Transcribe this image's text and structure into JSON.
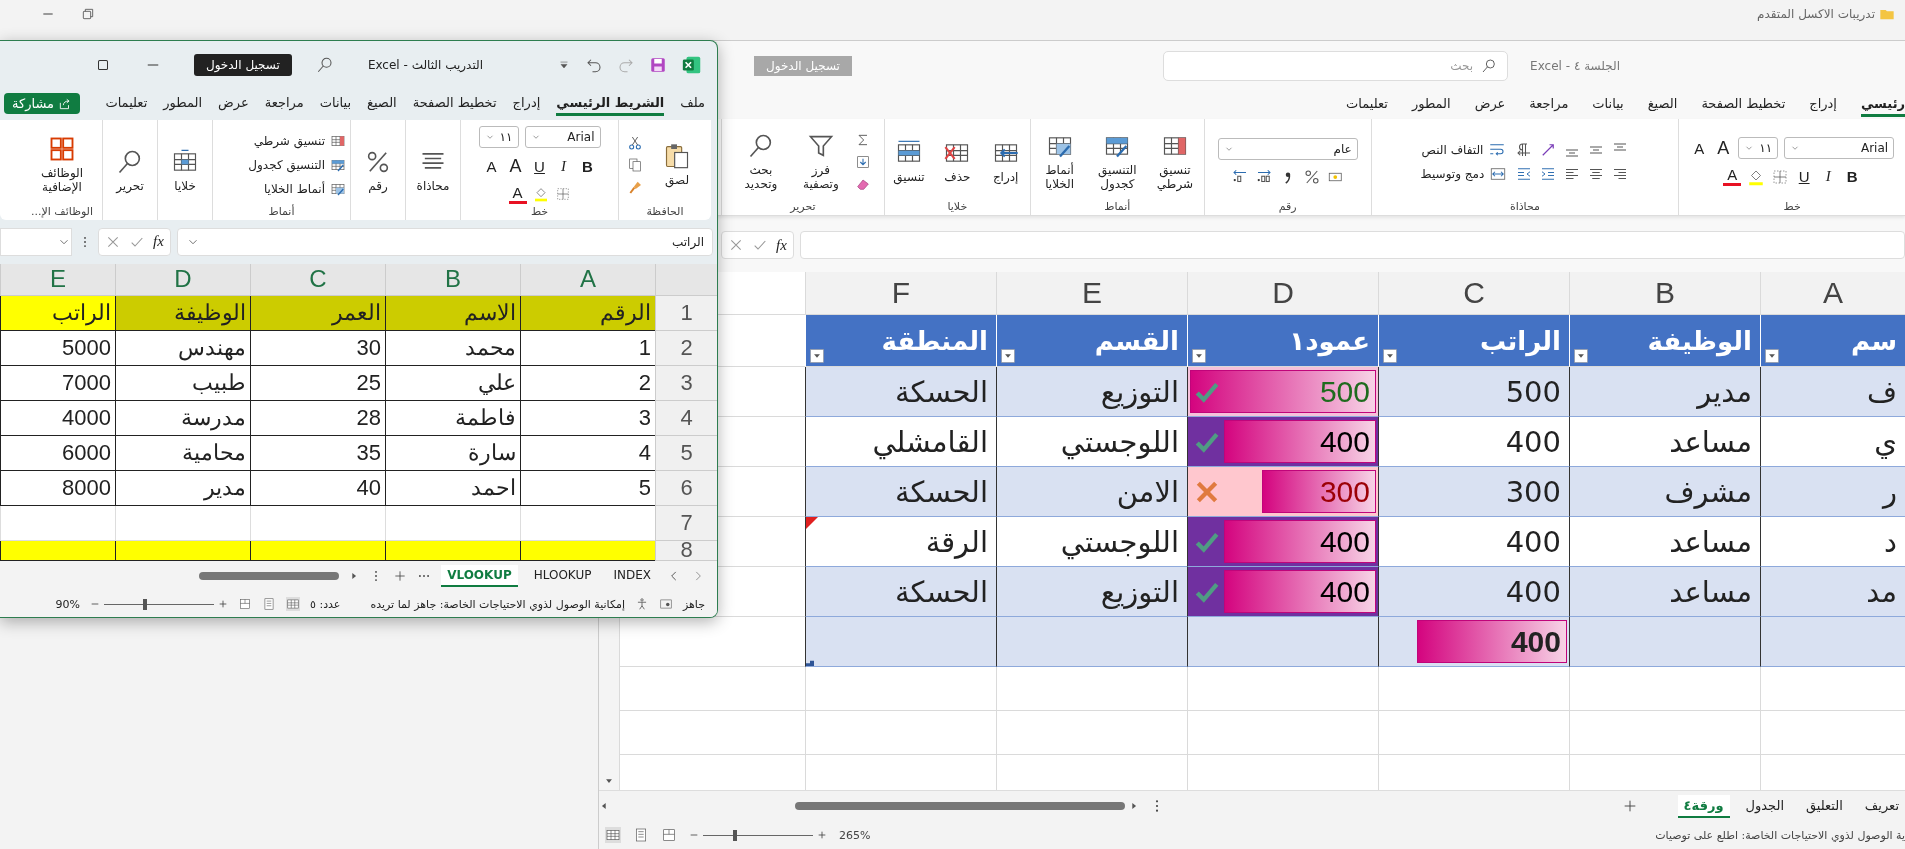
{
  "desktop": {
    "title": "تدريبات الاكسل المتقدم"
  },
  "back_window": {
    "document": "الجلسة ٤ - Excel",
    "sign_in": "تسجيل الدخول",
    "search": {
      "placeholder": "بحث"
    },
    "tabs": [
      {
        "label": "رئيسي",
        "selected": true
      },
      {
        "label": "إدراج",
        "selected": false
      },
      {
        "label": "تخطيط الصفحة",
        "selected": false
      },
      {
        "label": "الصيغ",
        "selected": false
      },
      {
        "label": "بيانات",
        "selected": false
      },
      {
        "label": "مراجعة",
        "selected": false
      },
      {
        "label": "عرض",
        "selected": false
      },
      {
        "label": "المطور",
        "selected": false
      },
      {
        "label": "تعليمات",
        "selected": false
      }
    ],
    "ribbon": {
      "font_group": "خط",
      "font_name": "Arial",
      "font_size": "١١",
      "grow": "A",
      "shrink": "A",
      "bold": "B",
      "italic": "I",
      "underline": "U",
      "font_color": "A",
      "alignment_group": "محاذاة",
      "wrap_text": "التفاف النص",
      "merge_center": "دمج وتوسيط",
      "number_group": "رقم",
      "number_format": "عام",
      "styles_group": "أنماط",
      "styles": [
        "تنسيق شرطي",
        "التنسيق كجدول",
        "أنماط الخلايا"
      ],
      "cells_group": "خلايا",
      "cells": [
        "إدراج",
        "حذف",
        "تنسيق"
      ],
      "editing_group": "تحرير",
      "editing": [
        "فرز وتصفية",
        "بحث وتحديد"
      ]
    },
    "fx": "fx",
    "sheet": {
      "column_letters": [
        "A",
        "B",
        "C",
        "D",
        "E",
        "F"
      ],
      "headers": [
        "سم",
        "الوظيفة",
        "الراتب",
        "عمود١",
        "القسم",
        "المنطقة"
      ],
      "rows": [
        {
          "name": "ف",
          "job": "مدير",
          "salary": "500",
          "score": {
            "value": "500",
            "kind": "top",
            "level": 1
          },
          "dept": "التوزيع",
          "region": "الحسكة",
          "comment": false
        },
        {
          "name": "ي",
          "job": "مساعد",
          "salary": "400",
          "score": {
            "value": "400",
            "kind": "mid",
            "level": 0.8
          },
          "dept": "اللوجستي",
          "region": "القامشلي",
          "comment": false
        },
        {
          "name": "ر",
          "job": "مشرف",
          "salary": "300",
          "score": {
            "value": "300",
            "kind": "low",
            "level": 0.6
          },
          "dept": "الامن",
          "region": "الحسكة",
          "comment": false
        },
        {
          "name": "د",
          "job": "مساعد",
          "salary": "400",
          "score": {
            "value": "400",
            "kind": "mid",
            "level": 0.8
          },
          "dept": "اللوجستي",
          "region": "الرقة",
          "comment": true
        },
        {
          "name": "مد",
          "job": "مساعد",
          "salary": "400",
          "score": {
            "value": "400",
            "kind": "mid",
            "level": 0.8
          },
          "dept": "التوزيع",
          "region": "الحسكة",
          "comment": false
        }
      ],
      "total": {
        "value": "400",
        "level": 0.79
      }
    },
    "sheet_tabs": [
      {
        "label": "تعريف",
        "selected": false
      },
      {
        "label": "التعليق",
        "selected": false
      },
      {
        "label": "الجدول",
        "selected": false
      },
      {
        "label": "ورقة٤",
        "selected": true
      }
    ],
    "status": "ية الوصول لذوي الاحتياجات الخاصة: اطلع على توصيات",
    "zoom": "265%",
    "zoom_slider": {
      "level": 0.27
    }
  },
  "front_window": {
    "document": "التدريب الثالث - Excel",
    "sign_in": "تسجيل الدخول",
    "tabs": [
      {
        "label": "ملف",
        "selected": false
      },
      {
        "label": "الشريط الرئيسي",
        "selected": true
      },
      {
        "label": "إدراج",
        "selected": false
      },
      {
        "label": "تخطيط الصفحة",
        "selected": false
      },
      {
        "label": "الصيغ",
        "selected": false
      },
      {
        "label": "بيانات",
        "selected": false
      },
      {
        "label": "مراجعة",
        "selected": false
      },
      {
        "label": "عرض",
        "selected": false
      },
      {
        "label": "المطور",
        "selected": false
      },
      {
        "label": "تعليمات",
        "selected": false
      }
    ],
    "share": "مشاركة",
    "ribbon": {
      "clipboard_group": "الحافظة",
      "paste": "لصق",
      "font_group": "خط",
      "font_name": "Arial",
      "font_size": "١١",
      "grow": "A",
      "shrink": "A",
      "bold": "B",
      "italic": "I",
      "underline": "U",
      "font_color": "A",
      "alignment": "محاذاة",
      "number": "رقم",
      "styles_group": "أنماط",
      "styles": [
        "تنسيق شرطي",
        "التنسيق كجدول",
        "أنماط الخلايا"
      ],
      "cells": "خلايا",
      "editing": "تحرير",
      "addins": "الوظائف الإضافية",
      "addins_group": "الوظائف الإ..."
    },
    "fx": "fx",
    "formula": "الراتب",
    "sheet": {
      "column_letters": [
        "A",
        "B",
        "C",
        "D",
        "E"
      ],
      "row_numbers": [
        "1",
        "2",
        "3",
        "4",
        "5",
        "6",
        "7",
        "8"
      ],
      "headers": [
        {
          "text": "الرقم",
          "color": "#cccc00"
        },
        {
          "text": "الاسم",
          "color": "#cccc00"
        },
        {
          "text": "العمر",
          "color": "#cccc00"
        },
        {
          "text": "الوظيفة",
          "color": "#cccc00"
        },
        {
          "text": "الراتب",
          "color": "#ffff00"
        }
      ],
      "rows": [
        [
          "1",
          "محمد",
          "30",
          "مهندس",
          "5000"
        ],
        [
          "2",
          "علي",
          "25",
          "طبيب",
          "7000"
        ],
        [
          "3",
          "فاطمة",
          "28",
          "مدرسة",
          "4000"
        ],
        [
          "4",
          "سارة",
          "35",
          "محامية",
          "6000"
        ],
        [
          "5",
          "احمد",
          "40",
          "مدير",
          "8000"
        ]
      ],
      "row_8": [
        {
          "color": "#ffff00"
        },
        {
          "color": "#ffff00"
        },
        {
          "color": "#ffff00"
        },
        {
          "color": "#ffff00"
        },
        {
          "color": "#ffff00"
        }
      ]
    },
    "sheet_tabs": [
      {
        "label": "INDEX",
        "selected": false
      },
      {
        "label": "HLOOKUP",
        "selected": false
      },
      {
        "label": "VLOOKUP",
        "selected": true
      }
    ],
    "status": {
      "ready": "جاهز",
      "accessibility": "إمكانية الوصول لذوي الاحتياجات الخاصة: جاهز لما تريده",
      "count": "عدد: ٥",
      "zoom": "90%",
      "zoom_slider": {
        "level": 0.35
      }
    }
  }
}
